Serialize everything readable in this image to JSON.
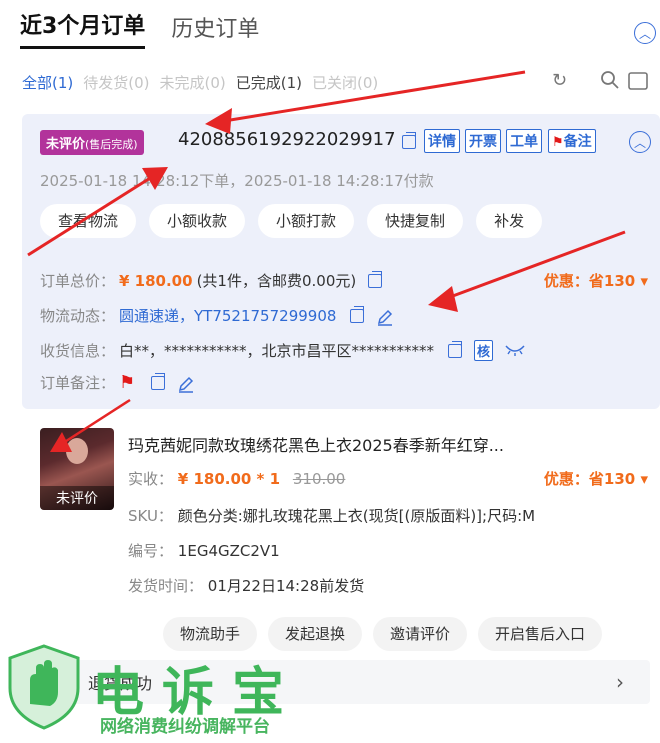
{
  "header": {
    "tabs": [
      {
        "label": "近3个月订单",
        "active": true
      },
      {
        "label": "历史订单",
        "active": false
      }
    ]
  },
  "filters": {
    "all": "全部(1)",
    "pending_ship": "待发货(0)",
    "incomplete": "未完成(0)",
    "completed": "已完成(1)",
    "closed": "已关闭(0)"
  },
  "order": {
    "status_badge": "未评价",
    "status_badge_sub": "(售后完成)",
    "order_number": "4208856192922029917",
    "tags": [
      "详情",
      "开票",
      "工单",
      "备注"
    ],
    "times": "2025-01-18 14:28:12下单，2025-01-18 14:28:17付款",
    "pills": [
      "查看物流",
      "小额收款",
      "小额打款",
      "快捷复制",
      "补发"
    ],
    "total_label": "订单总价：",
    "total_price": "¥ 180.00",
    "total_detail": "(共1件，含邮费0.00元)",
    "discount": "优惠：省130 ▾",
    "logistics_label": "物流动态：",
    "logistics_value": "圆通速递，YT7521757299908",
    "receiver_label": "收货信息：",
    "receiver_value": "白**，***********，北京市昌平区***********",
    "receiver_tag": "核",
    "remark_label": "订单备注："
  },
  "product": {
    "image_label": "未评价",
    "title": "玛克茜妮同款玫瑰绣花黑色上衣2025春季新年红穿...",
    "price_label": "实收：",
    "price": "¥ 180.00 * 1",
    "original_price": "310.00",
    "discount": "优惠：省130 ▾",
    "sku_label": "SKU：",
    "sku_value": "颜色分类:娜扎玫瑰花黑上衣(现货[(原版面料)];尺码:M",
    "code_label": "编号：",
    "code_value": "1EG4GZC2V1",
    "ship_label": "发货时间：",
    "ship_value": "01月22日14:28前发货",
    "actions": [
      "物流助手",
      "发起退换",
      "邀请评价",
      "开启售后入口"
    ],
    "refund_status": "退货成功"
  },
  "watermark": {
    "title": "电诉宝",
    "subtitle": "网络消费纠纷调解平台"
  },
  "colors": {
    "accent_blue": "#2f6ad3",
    "price_orange": "#f16b1b",
    "badge_purple": "#b2339b",
    "arrow_red": "#e52525",
    "watermark_green": "#3fb65a"
  }
}
